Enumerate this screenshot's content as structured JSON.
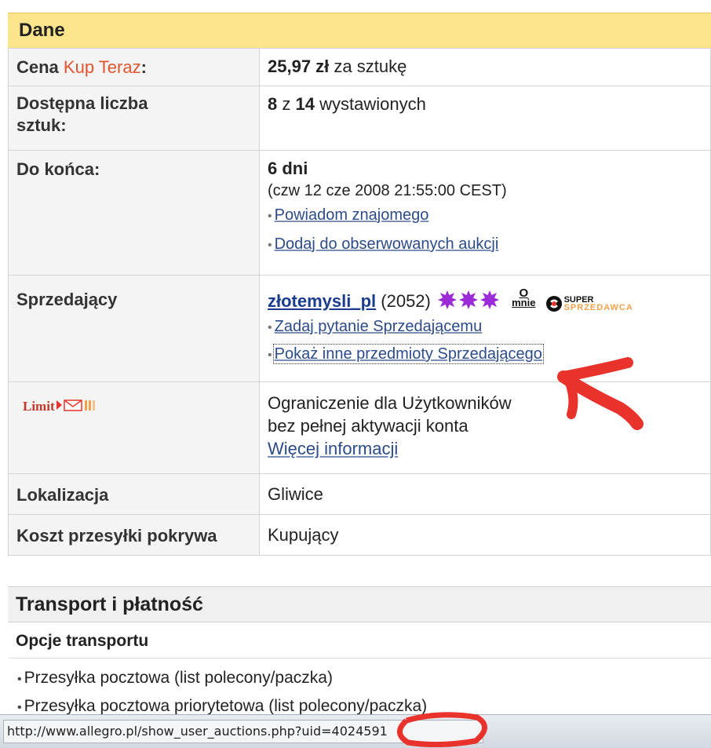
{
  "dane": {
    "title": "Dane",
    "rows": {
      "cena": {
        "label_prefix": "Cena ",
        "label_kup": "Kup Teraz",
        "label_suffix": ":",
        "price": "25,97 zł",
        "price_suffix": " za sztukę"
      },
      "liczba": {
        "label": "Dostępna liczba sztuk:",
        "available": "8",
        "z": " z ",
        "total": "14",
        "suffix": " wystawionych"
      },
      "koniec": {
        "label": "Do końca:",
        "days": "6 dni",
        "date": "(czw 12 cze 2008 21:55:00 CEST)",
        "link1": "Powiadom znajomego",
        "link2": "Dodaj do obserwowanych aukcji"
      },
      "sprzedajacy": {
        "label": "Sprzedający",
        "seller_name": "złotemysli_pl",
        "rating": " (2052)",
        "omnie_top": "O",
        "omnie_bottom": "mnie",
        "super_top": "SUPER",
        "super_bottom": "SPRZEDAWCA",
        "link1": "Zadaj pytanie Sprzedającemu",
        "link2": "Pokaż inne przedmioty Sprzedającego"
      },
      "limit": {
        "logo_text": "Limit",
        "line1": "Ograniczenie dla Użytkowników",
        "line2": "bez pełnej aktywacji konta",
        "link": "Więcej informacji"
      },
      "lokalizacja": {
        "label": "Lokalizacja",
        "value": "Gliwice"
      },
      "koszt": {
        "label": "Koszt przesyłki pokrywa",
        "value": "Kupujący"
      }
    }
  },
  "transport": {
    "title": "Transport i płatność",
    "subtitle": "Opcje transportu",
    "items": [
      "Przesyłka pocztowa (list polecony/paczka)",
      "Przesyłka pocztowa priorytetowa (list polecony/paczka)"
    ]
  },
  "statusbar": {
    "url": "http://www.allegro.pl/show_user_auctions.php?uid=4024591"
  },
  "colors": {
    "header_bg": "#fbe48b",
    "kup_teraz": "#e0552d",
    "link": "#2c4b8a",
    "star": "#9b2bd6",
    "annotation": "#e8322b"
  },
  "icons": {
    "star": "purple-star-icon",
    "limit": "limit-envelope-icon",
    "super": "super-sprzedawca-icon"
  }
}
